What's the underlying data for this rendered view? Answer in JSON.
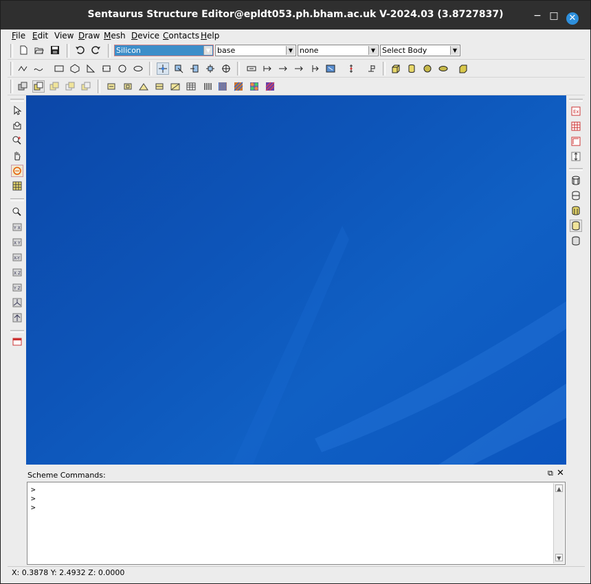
{
  "window": {
    "title": "Sentaurus Structure Editor@epldt053.ph.bham.ac.uk V-2024.03 (3.8727837)",
    "minimize_glyph": "−",
    "maximize_glyph": "□",
    "close_glyph": "✕"
  },
  "menubar": {
    "items": [
      {
        "underline": "F",
        "rest": "ile"
      },
      {
        "underline": "E",
        "rest": "dit"
      },
      {
        "underline": "",
        "rest": "View"
      },
      {
        "underline": "D",
        "rest": "raw"
      },
      {
        "underline": "M",
        "rest": "esh"
      },
      {
        "underline": "D",
        "rest": "evice"
      },
      {
        "underline": "C",
        "rest": "ontacts"
      },
      {
        "underline": "H",
        "rest": "elp"
      }
    ]
  },
  "toolbar1": {
    "material": "Silicon",
    "region": "base",
    "contact": "none",
    "body": "Select Body"
  },
  "scheme": {
    "label": "Scheme Commands:",
    "float_glyph": "⧉",
    "close_glyph": "✕",
    "lines": [
      ">",
      ">",
      ">"
    ]
  },
  "status": {
    "coords": "X: 0.3878 Y: 2.4932 Z: 0.0000"
  },
  "colors": {
    "titlebar": "#2f2f2f",
    "close_accent": "#2d8fdc",
    "viewport_blue": "#0d55b9",
    "selected_material": "#3d8ec9"
  }
}
